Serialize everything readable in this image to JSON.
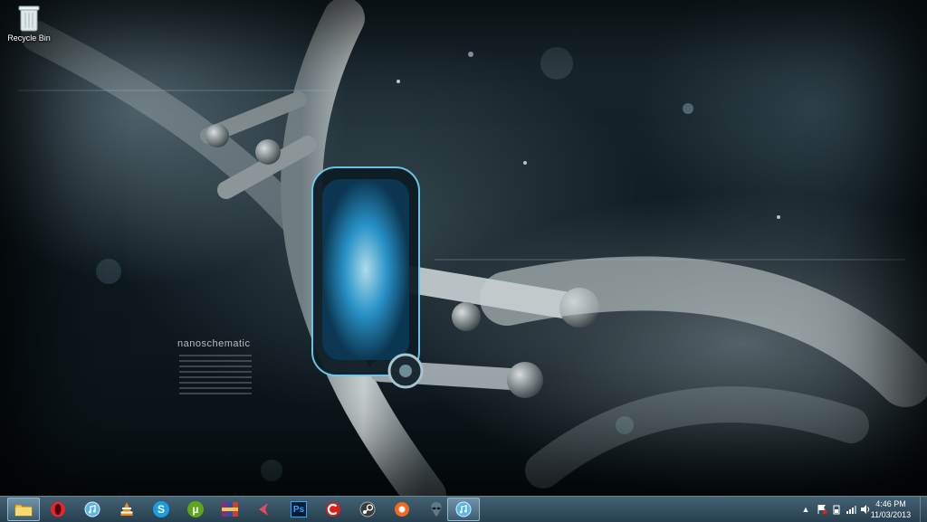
{
  "desktop": {
    "icons": [
      {
        "label": "Recycle Bin",
        "icon": "recycle-bin-icon"
      }
    ],
    "wallpaper_text": "nanoschematic"
  },
  "taskbar": {
    "pinned": [
      {
        "name": "file-explorer",
        "icon": "folder-icon",
        "active": true
      },
      {
        "name": "opera",
        "icon": "opera-icon"
      },
      {
        "name": "itunes",
        "icon": "itunes-icon"
      },
      {
        "name": "vlc",
        "icon": "vlc-icon"
      },
      {
        "name": "skype",
        "icon": "skype-icon",
        "glyph": "S"
      },
      {
        "name": "utorrent",
        "icon": "utorrent-icon",
        "glyph": "µ"
      },
      {
        "name": "winrar",
        "icon": "winrar-icon"
      },
      {
        "name": "app-arrow",
        "icon": "arrow-app-icon"
      },
      {
        "name": "photoshop",
        "icon": "photoshop-icon",
        "glyph": "Ps"
      },
      {
        "name": "ccleaner",
        "icon": "ccleaner-icon"
      },
      {
        "name": "steam",
        "icon": "steam-icon"
      },
      {
        "name": "app-orange",
        "icon": "orange-circle-icon"
      },
      {
        "name": "alienware",
        "icon": "alien-icon"
      },
      {
        "name": "itunes-2",
        "icon": "itunes-icon",
        "active": true
      }
    ],
    "tray": {
      "show_hidden_glyph": "▲",
      "icons": [
        "action-center-flag-icon",
        "power-icon",
        "network-signal-icon",
        "volume-icon"
      ]
    },
    "clock": {
      "time": "4:46 PM",
      "date": "11/03/2013"
    }
  },
  "colors": {
    "opera": "#e3262e",
    "skype": "#1a9fe0",
    "utorrent": "#5da61a",
    "photoshop": "#001d34",
    "ccleaner": "#d6201b",
    "steam": "#3a3a3a",
    "orange": "#f26a21",
    "taskbar": "#3a5a6e"
  }
}
